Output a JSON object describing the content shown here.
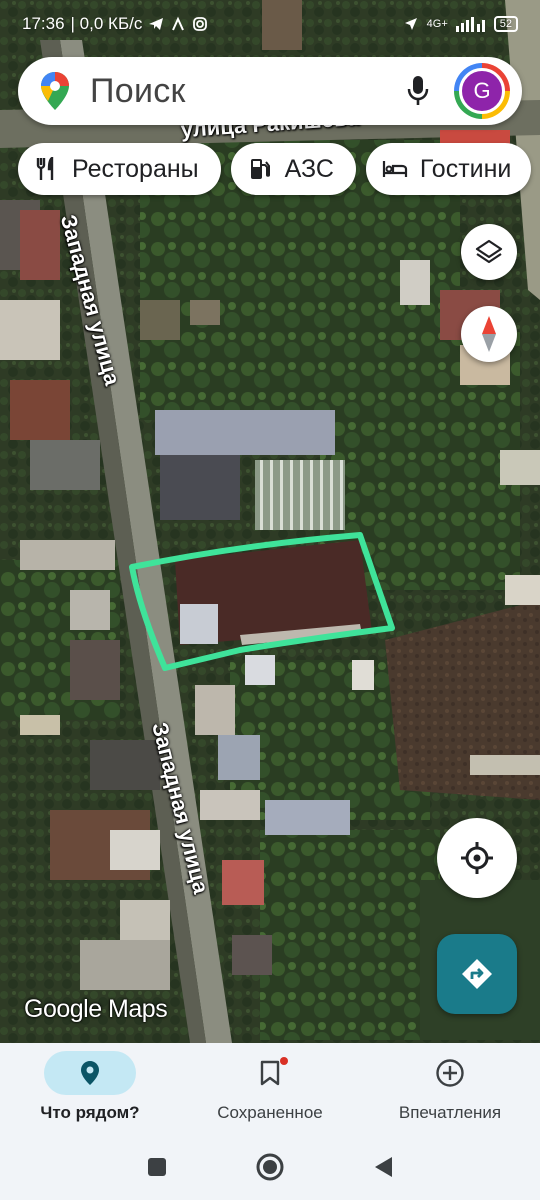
{
  "status_bar": {
    "time": "17:36",
    "network_speed": "| 0,0 КБ/с",
    "network_type": "4G+",
    "battery": "52"
  },
  "search": {
    "placeholder": "Поиск",
    "avatar_letter": "G",
    "icons": [
      "google-maps-pin-icon",
      "mic-icon"
    ]
  },
  "chips": [
    {
      "label": "Рестораны",
      "icon": "restaurant-icon"
    },
    {
      "label": "АЗС",
      "icon": "gas-station-icon"
    },
    {
      "label": "Гостини",
      "icon": "hotel-bed-icon"
    }
  ],
  "map": {
    "street_labels": {
      "west_top": "Западная улица",
      "west_bottom": "Западная улица",
      "top": "улица Ракишева"
    },
    "watermark": "Google Maps",
    "highlight_color": "#3fe39a"
  },
  "bottom_nav": [
    {
      "label": "Что рядом?",
      "icon": "location-pin-icon",
      "active": true
    },
    {
      "label": "Сохраненное",
      "icon": "bookmark-icon",
      "active": false
    },
    {
      "label": "Впечатления",
      "icon": "add-circle-icon",
      "active": false
    }
  ],
  "colors": {
    "accent_active_nav": "#c4e8f4",
    "directions_button": "#1a7b8a",
    "avatar_bg": "#8e24aa"
  }
}
